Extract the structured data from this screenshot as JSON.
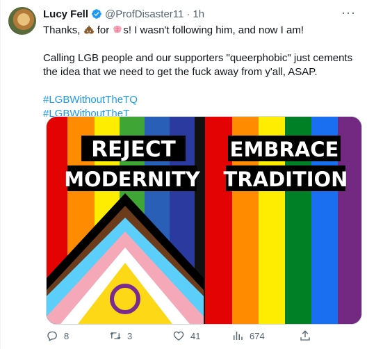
{
  "tweet": {
    "author_name": "Lucy Fell",
    "handle": "@ProfDisaster11",
    "separator": "·",
    "time": "1h",
    "text_part1": "Thanks, ",
    "text_part2": " for ",
    "text_part3": "s! I wasn't following him, and now I am!",
    "paragraph2": "Calling LGB people and our supporters \"queerphobic\" just cements the idea that we need to get the fuck away from y'all, ASAP.",
    "hashtags": [
      "#LGBWithoutTheTQ",
      "#LGBWithoutTheT"
    ],
    "more_label": "···"
  },
  "media": {
    "left_line1": "REJECT",
    "left_line2": "MODERNITY",
    "right_line1": "EMBRACE",
    "right_line2": "TRADITION"
  },
  "actions": {
    "replies": "8",
    "retweets": "3",
    "likes": "41",
    "views": "674"
  },
  "colors": {
    "accent": "#1d9bf0",
    "verified": "#1d9bf0",
    "muted_text": "#536471"
  }
}
